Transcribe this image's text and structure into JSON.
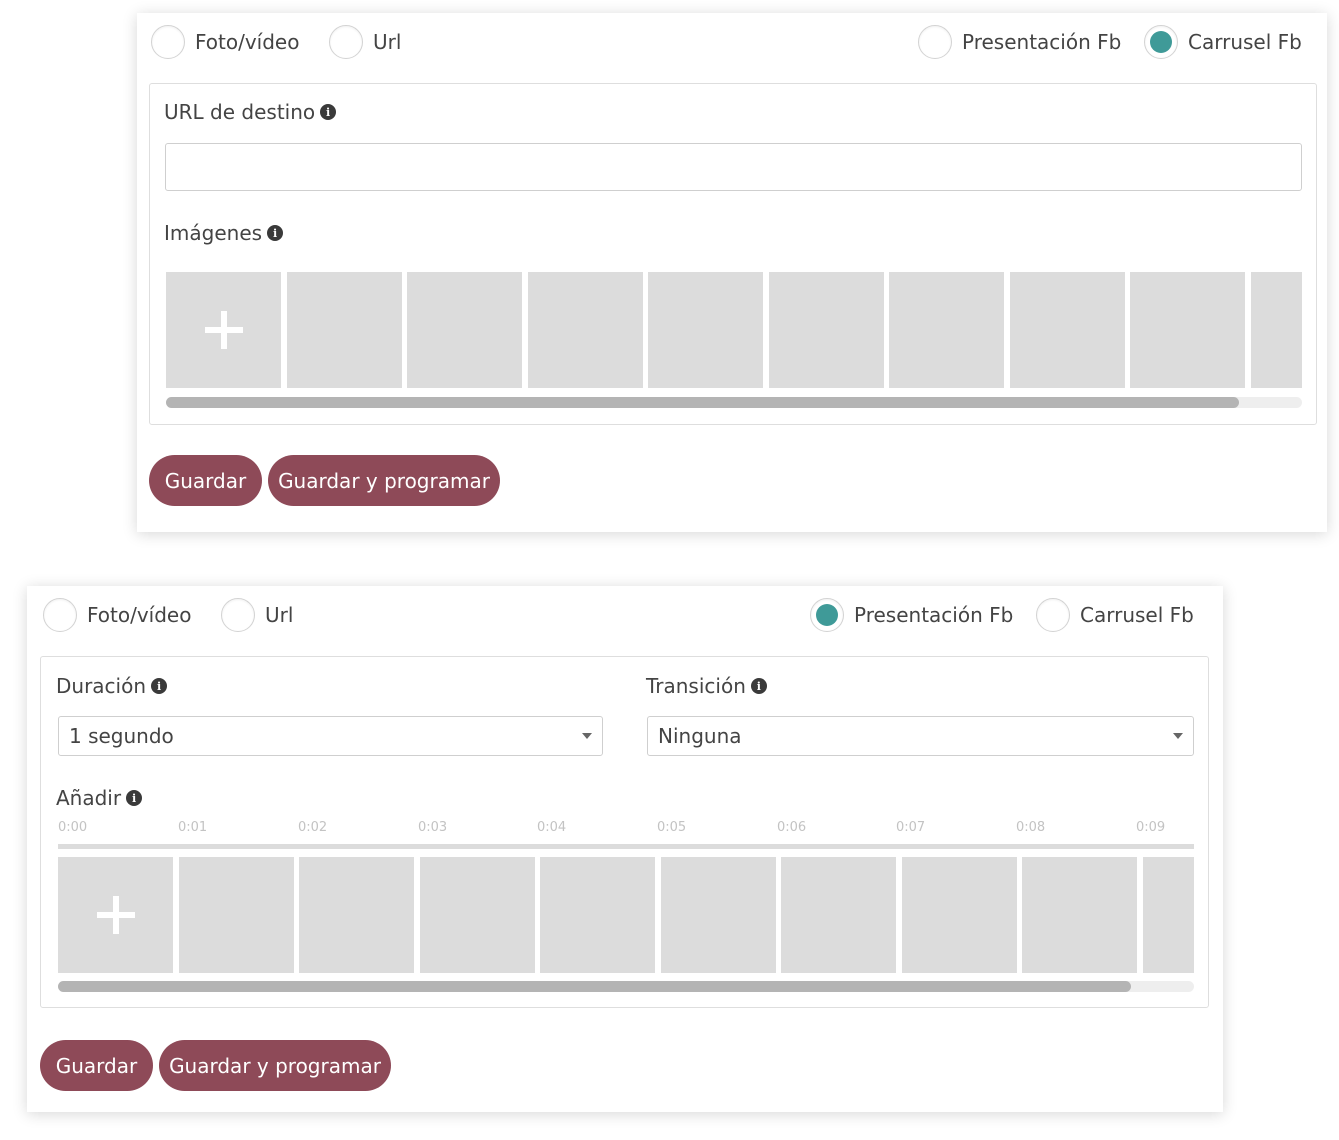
{
  "colors": {
    "accent": "#3f9a98",
    "button": "#8e4a58",
    "thumb": "#dcdcdc",
    "scroll_thumb": "#b4b4b4"
  },
  "carousel_form": {
    "options": [
      {
        "label": "Foto/vídeo",
        "checked": false
      },
      {
        "label": "Url",
        "checked": false
      },
      {
        "label": "Presentación Fb",
        "checked": false
      },
      {
        "label": "Carrusel Fb",
        "checked": true
      }
    ],
    "url_label": "URL de destino",
    "url_value": "",
    "images_label": "Imágenes",
    "save_label": "Guardar",
    "save_schedule_label": "Guardar y programar"
  },
  "slideshow_form": {
    "options": [
      {
        "label": "Foto/vídeo",
        "checked": false
      },
      {
        "label": "Url",
        "checked": false
      },
      {
        "label": "Presentación Fb",
        "checked": true
      },
      {
        "label": "Carrusel Fb",
        "checked": false
      }
    ],
    "duration_label": "Duración",
    "duration_value": "1 segundo",
    "transition_label": "Transición",
    "transition_value": "Ninguna",
    "add_label": "Añadir",
    "timeline_ticks": [
      "0:00",
      "0:01",
      "0:02",
      "0:03",
      "0:04",
      "0:05",
      "0:06",
      "0:07",
      "0:08",
      "0:09"
    ],
    "save_label": "Guardar",
    "save_schedule_label": "Guardar y programar"
  }
}
